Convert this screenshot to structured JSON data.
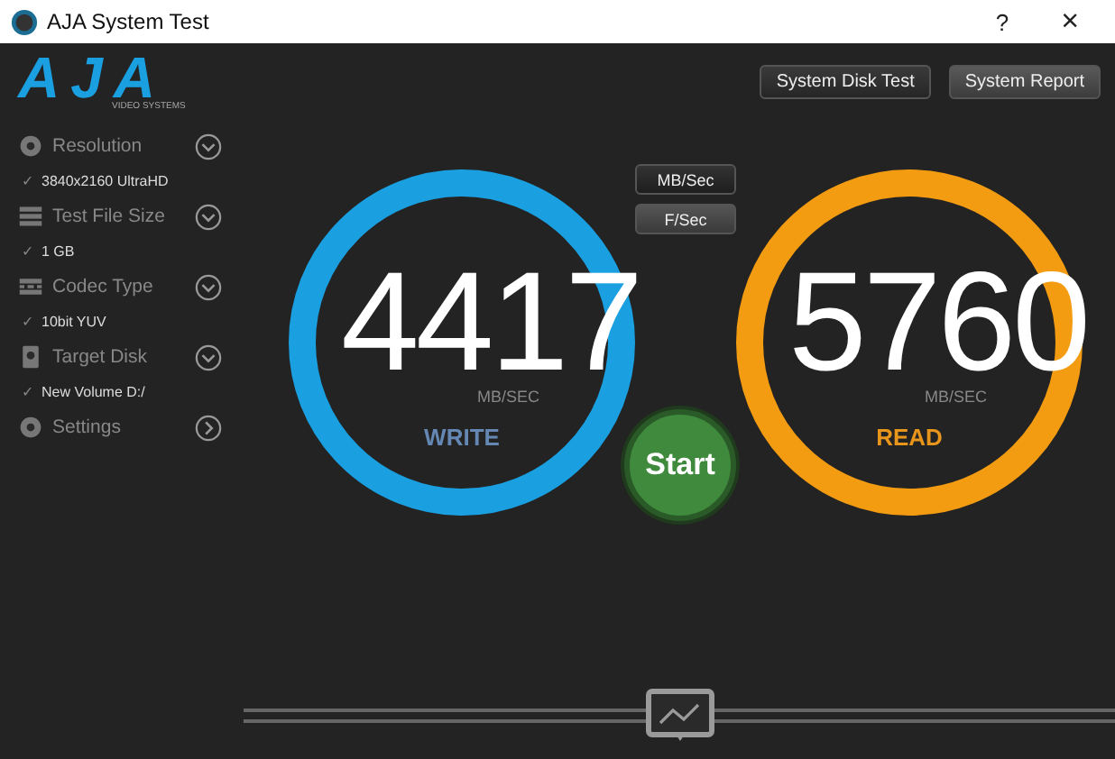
{
  "window": {
    "title": "AJA System Test",
    "help": "?",
    "close": "×"
  },
  "logo": {
    "mark": "AJA",
    "tagline": "VIDEO SYSTEMS"
  },
  "header_buttons": [
    "System Disk Test",
    "System Report"
  ],
  "sidebar": {
    "items": [
      {
        "kind": "dropdown",
        "label": "Resolution",
        "value": "3840x2160 UltraHD"
      },
      {
        "kind": "dropdown",
        "label": "Test File Size",
        "value": "1 GB"
      },
      {
        "kind": "dropdown",
        "label": "Codec Type",
        "value": "10bit YUV"
      },
      {
        "kind": "dropdown",
        "label": "Target Disk",
        "value": "New Volume D:/"
      },
      {
        "kind": "link",
        "label": "Settings"
      }
    ]
  },
  "check": "✓",
  "units": [
    {
      "label": "MB/Sec",
      "selected": true
    },
    {
      "label": "F/Sec",
      "selected": false
    }
  ],
  "gauges": [
    {
      "kind": "write",
      "value": "4417",
      "unit": "MB/SEC",
      "label": "WRITE"
    },
    {
      "kind": "read",
      "value": "5760",
      "unit": "MB/SEC",
      "label": "READ"
    }
  ],
  "start_button": "Start"
}
